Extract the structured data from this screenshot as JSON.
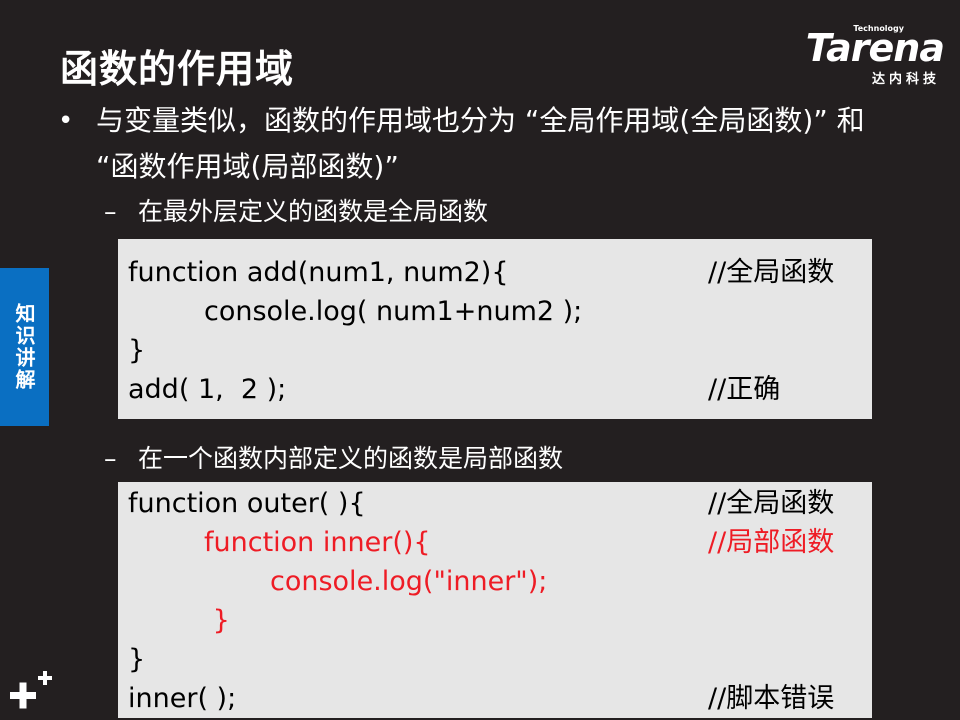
{
  "title": "函数的作用域",
  "logo": {
    "tech": "Technology",
    "word": "Tarena",
    "cn": "达内科技"
  },
  "side_tab": "知识讲解",
  "bullet": {
    "marker": "•",
    "text": "与变量类似，函数的作用域也分为 “全局作用域(全局函数)” 和 “函数作用域(局部函数)”"
  },
  "sub_items": [
    {
      "dash": "–",
      "text": "在最外层定义的函数是全局函数"
    },
    {
      "dash": "–",
      "text": "在一个函数内部定义的函数是局部函数"
    }
  ],
  "code_block_1": {
    "lines": [
      {
        "code": "function add(num1, num2){",
        "comment": "//全局函数",
        "indent": 0,
        "color": "#000000"
      },
      {
        "code": "console.log( num1+num2 );",
        "comment": "",
        "indent": 1,
        "color": "#000000"
      },
      {
        "code": "}",
        "comment": "",
        "indent": 0,
        "color": "#000000"
      },
      {
        "code": "add( 1,  2 );",
        "comment": "//正确",
        "indent": 0,
        "color": "#000000"
      }
    ]
  },
  "code_block_2": {
    "lines": [
      {
        "code": "function outer( ){",
        "comment": "//全局函数",
        "indent": 0,
        "color": "#000000"
      },
      {
        "code": "function inner(){",
        "comment": "//局部函数",
        "indent": 1,
        "color": "#ee1c25"
      },
      {
        "code": "console.log(\"inner\");",
        "comment": "",
        "indent": 2,
        "color": "#ee1c25"
      },
      {
        "code": " }",
        "comment": "",
        "indent": 1,
        "color": "#ee1c25"
      },
      {
        "code": "}",
        "comment": "",
        "indent": 0,
        "color": "#000000"
      },
      {
        "code": "inner( );",
        "comment": "//脚本错误",
        "indent": 0,
        "color": "#000000"
      }
    ]
  },
  "colors": {
    "background": "#231f20",
    "side_tab": "#0a6fc2",
    "code_background": "#e6e6e6",
    "highlight_red": "#ee1c25"
  },
  "icons": {
    "corner": "plus-sparkle-icon"
  }
}
